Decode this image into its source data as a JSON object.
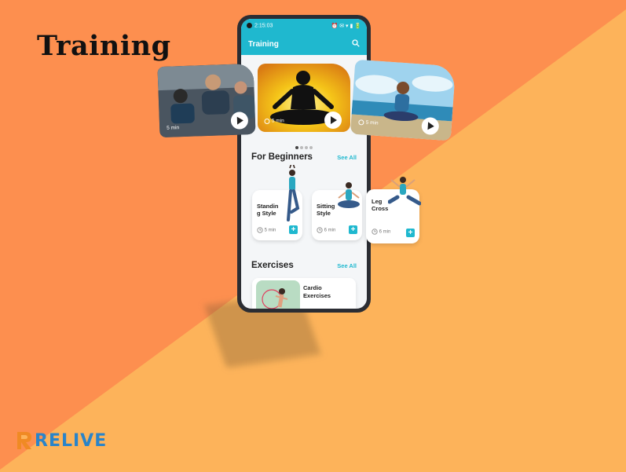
{
  "page": {
    "title": "Training"
  },
  "colors": {
    "bg_dark": "#fd8f4f",
    "bg_light": "#fdb35a",
    "accent": "#1fb8cf",
    "logo_blue": "#2a84c9",
    "logo_orange": "#f08a24"
  },
  "status_bar": {
    "time": "2:15:03",
    "icons": "⏰ ✉ ▾ ▮ 🔋"
  },
  "app_bar": {
    "title": "Training",
    "search_icon": "search-icon"
  },
  "videos": [
    {
      "duration": "5 min"
    },
    {
      "duration": "5 min"
    },
    {
      "duration": "5 min"
    }
  ],
  "beginners": {
    "heading": "For Beginners",
    "see_all": "See All",
    "items": [
      {
        "label": "Standin g Style",
        "duration": "5 min"
      },
      {
        "label": "Sitting Style",
        "duration": "6 min"
      },
      {
        "label": "Leg Cross",
        "duration": "6 min"
      }
    ]
  },
  "exercises": {
    "heading": "Exercises",
    "see_all": "See All",
    "items": [
      {
        "label": "Cardio Exercises"
      }
    ]
  },
  "logo": {
    "text": "RELIVE"
  }
}
